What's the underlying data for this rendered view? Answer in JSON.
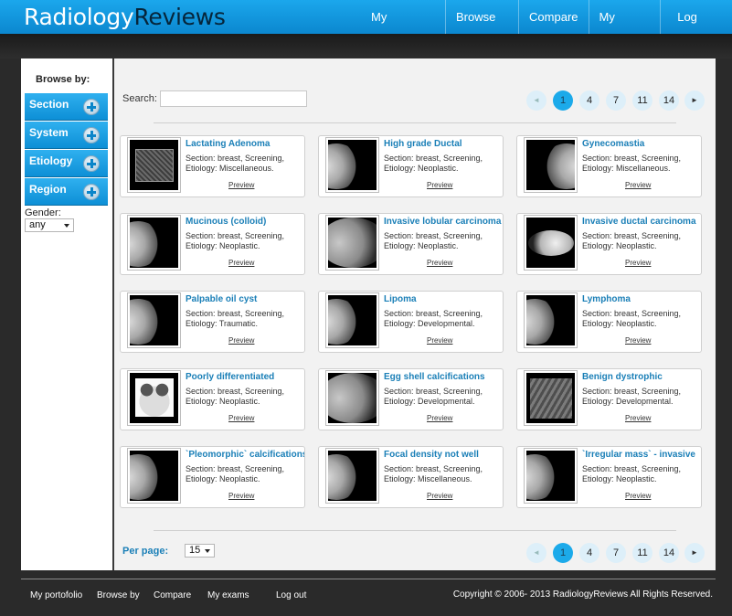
{
  "header": {
    "logo_part1": "Radiology",
    "logo_part2": "Reviews",
    "nav": [
      "My portofolio",
      "Browse by",
      "Compare",
      "My exams",
      "Log out"
    ]
  },
  "sidebar": {
    "title": "Browse by:",
    "sections": [
      "Section",
      "System",
      "Etiology",
      "Region"
    ],
    "gender_label": "Gender:",
    "gender_value": "any"
  },
  "search": {
    "label": "Search:",
    "value": ""
  },
  "pagination": {
    "pages": [
      "1",
      "4",
      "7",
      "11",
      "14"
    ],
    "current": "1",
    "prev_icon": "triangle-left-icon",
    "next_icon": "triangle-right-icon"
  },
  "cards": [
    {
      "title": "Lactating Adenoma",
      "meta1": "Section: breast, Screening,",
      "meta2": "Etiology: Miscellaneous.",
      "preview": "Preview",
      "thumb": "square"
    },
    {
      "title": "High grade Ductal",
      "meta1": "Section: breast, Screening,",
      "meta2": "Etiology: Neoplastic.",
      "preview": "Preview",
      "thumb": "breast"
    },
    {
      "title": "Gynecomastia",
      "meta1": "Section: breast, Screening,",
      "meta2": "Etiology: Miscellaneous.",
      "preview": "Preview",
      "thumb": "breast-right"
    },
    {
      "title": "Mucinous (colloid)",
      "meta1": "Section: breast, Screening,",
      "meta2": "Etiology: Neoplastic.",
      "preview": "Preview",
      "thumb": "breast"
    },
    {
      "title": "Invasive lobular carcinoma",
      "meta1": "Section: breast, Screening,",
      "meta2": "Etiology: Neoplastic.",
      "preview": "Preview",
      "thumb": "wide"
    },
    {
      "title": "Invasive ductal carcinoma",
      "meta1": "Section: breast, Screening,",
      "meta2": "Etiology: Neoplastic.",
      "preview": "Preview",
      "thumb": "blob"
    },
    {
      "title": "Palpable oil cyst",
      "meta1": "Section: breast, Screening,",
      "meta2": "Etiology: Traumatic.",
      "preview": "Preview",
      "thumb": "breast"
    },
    {
      "title": "Lipoma",
      "meta1": "Section: breast, Screening,",
      "meta2": "Etiology: Developmental.",
      "preview": "Preview",
      "thumb": "breast"
    },
    {
      "title": "Lymphoma",
      "meta1": "Section: breast, Screening,",
      "meta2": "Etiology: Neoplastic.",
      "preview": "Preview",
      "thumb": "breast"
    },
    {
      "title": "Poorly differentiated",
      "meta1": "Section: breast, Screening,",
      "meta2": "Etiology: Neoplastic.",
      "preview": "Preview",
      "thumb": "bright"
    },
    {
      "title": "Egg shell calcifications",
      "meta1": "Section: breast, Screening,",
      "meta2": "Etiology: Developmental.",
      "preview": "Preview",
      "thumb": "wide"
    },
    {
      "title": "Benign dystrophic",
      "meta1": "Section: breast, Screening,",
      "meta2": "Etiology: Developmental.",
      "preview": "Preview",
      "thumb": "gray"
    },
    {
      "title": "`Pleomorphic` calcifications",
      "meta1": "Section: breast, Screening,",
      "meta2": "Etiology: Neoplastic.",
      "preview": "Preview",
      "thumb": "breast"
    },
    {
      "title": "Focal density not well",
      "meta1": "Section: breast, Screening,",
      "meta2": "Etiology: Miscellaneous.",
      "preview": "Preview",
      "thumb": "breast"
    },
    {
      "title": "`Irregular mass` - invasive",
      "meta1": "Section: breast, Screening,",
      "meta2": "Etiology: Neoplastic.",
      "preview": "Preview",
      "thumb": "breast"
    }
  ],
  "per_page": {
    "label": "Per page:",
    "value": "15"
  },
  "footer": {
    "nav": [
      "My portofolio",
      "Browse by",
      "Compare",
      "My exams",
      "Log out"
    ],
    "copyright": "Copyright © 2006- 2013 RadiologyReviews All Rights Reserved."
  },
  "colors": {
    "brand_blue": "#1ba7ec",
    "link_blue": "#1a7fb7",
    "page_active": "#1caaea"
  }
}
